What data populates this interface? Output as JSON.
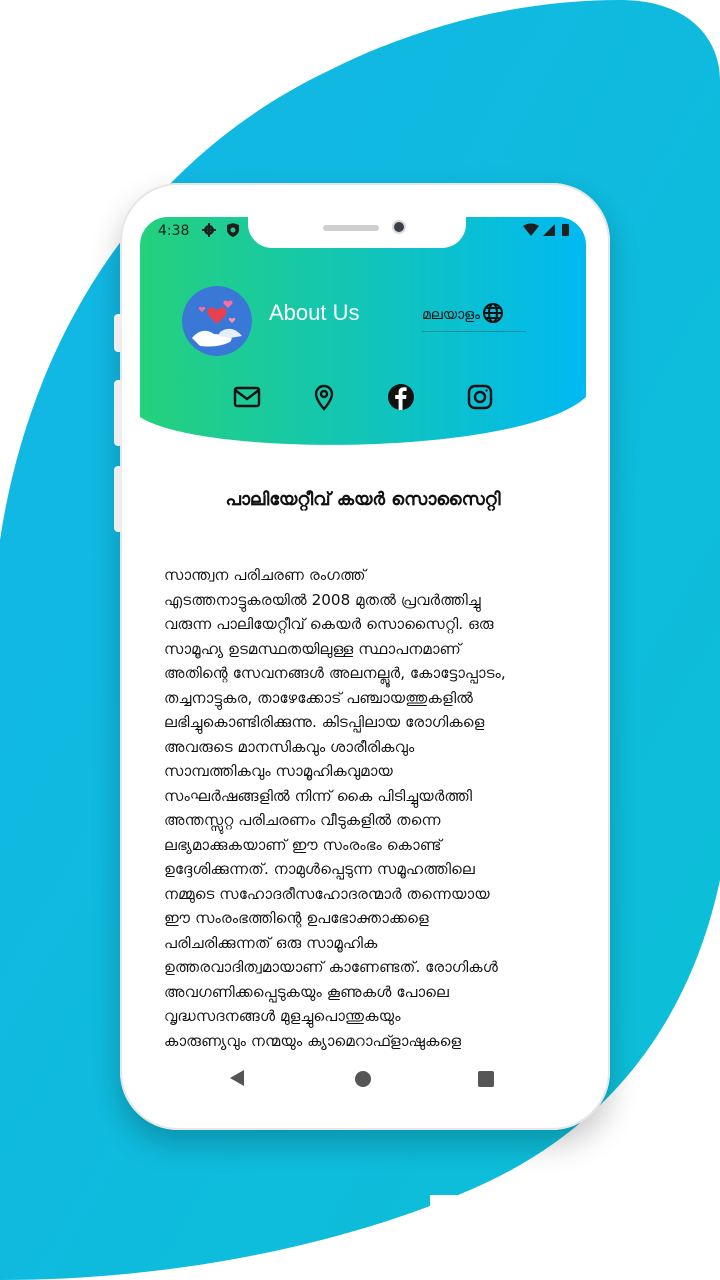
{
  "colors": {
    "header_gradient_start": "#22d17e",
    "header_gradient_end": "#00b9f2",
    "background_blob": "#10b8e0"
  },
  "status_bar": {
    "time": "4:38",
    "left_icons": [
      "settings-icon",
      "shield-icon"
    ],
    "right_icons": [
      "wifi-icon",
      "signal-icon",
      "battery-icon"
    ]
  },
  "header": {
    "logo": "hands-holding-heart-logo",
    "title": "About Us",
    "language_label": "മലയാളം",
    "language_icon": "globe-icon"
  },
  "contact_icons": [
    "mail-icon",
    "location-pin-icon",
    "facebook-icon",
    "instagram-icon"
  ],
  "content": {
    "title": "പാലിയേറ്റീവ് കയർ സൊസൈറ്റി",
    "body": "സാന്ത്വന പരിചരണ രംഗത്ത്\nഎടത്തനാട്ടുകരയിൽ 2008 മുതൽ പ്രവർത്തിച്ചു\nവരുന്ന പാലിയേറ്റീവ് കെയർ സൊസൈറ്റി. ഒരു\nസാമൂഹ്യ ഉടമസ്ഥതയിലുള്ള സ്ഥാപനമാണ്\nഅതിന്റെ സേവനങ്ങൾ അലനല്ലൂർ, കോട്ടോപ്പാടം,\nതച്ചനാട്ടുകര, താഴേക്കോട് പഞ്ചായത്തുകളിൽ\nലഭിച്ചുകൊണ്ടിരിക്കുന്നു. കിടപ്പിലായ രോഗികളെ\nഅവരുടെ മാനസികവും ശാരീരികവും\nസാമ്പത്തികവും സാമൂഹികവുമായ\nസംഘർഷങ്ങളിൽ നിന്ന് കൈ പിടിച്ചുയർത്തി\nഅന്തസ്സുറ്റ പരിചരണം വീടുകളിൽ തന്നെ\nലഭ്യമാക്കുകയാണ് ഈ സംരംഭം കൊണ്ട്\nഉദ്ദേശിക്കുന്നത്. നാമുൾപ്പെടുന്ന സമൂഹത്തിലെ\nനമ്മുടെ സഹോദരീസഹോദരന്മാർ തന്നെയായ\nഈ സംരംഭത്തിന്റെ ഉപഭോക്താക്കളെ\nപരിചരിക്കുന്നത് ഒരു സാമൂഹിക\nഉത്തരവാദിത്വമായാണ് കാണേണ്ടത്. രോഗികൾ\nഅവഗണിക്കപ്പെടുകയും കൂണുകൾ പോലെ\nവൃദ്ധസദനങ്ങൾ  മുളച്ചുപൊന്തുകയും\nകാരുണ്യവും നന്മയും ക്യാമെറാഫ്ളാഷുകളെ\nമാത്രം നിറം പിടിപ്പിക്കുകയും ചെയുമ്പോൾ\nപാലിയേറ്റീവ് കെയറിന്റെ പ്രവർത്തനങ്ങൾ"
  },
  "nav_bar": {
    "icons": [
      "back-icon",
      "home-icon",
      "recents-icon"
    ]
  }
}
